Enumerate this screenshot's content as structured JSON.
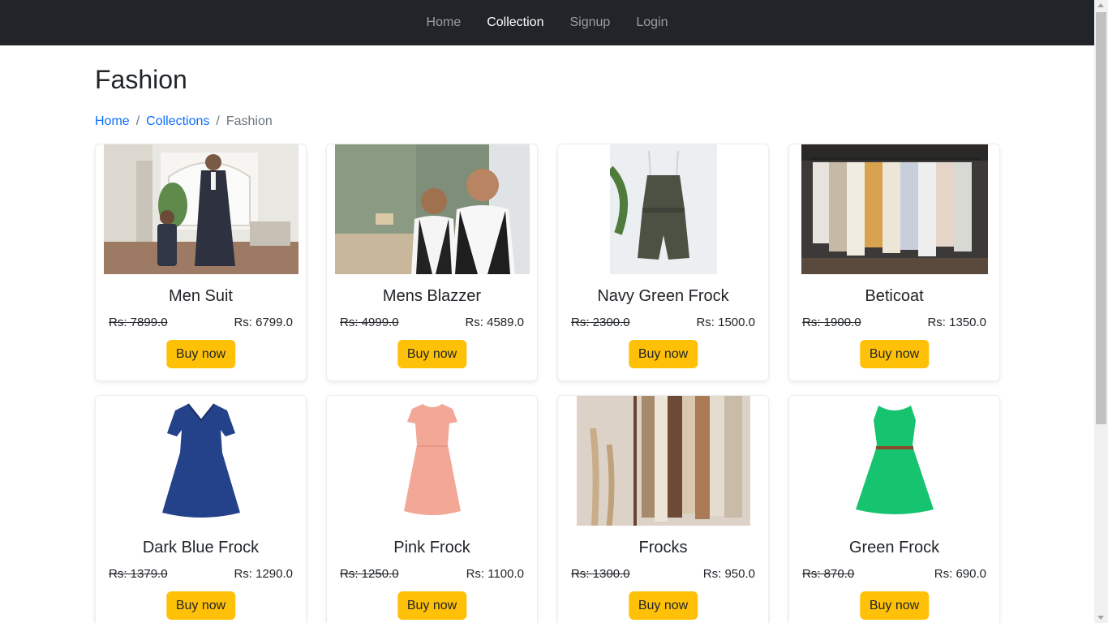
{
  "nav": {
    "items": [
      {
        "label": "Home",
        "active": false
      },
      {
        "label": "Collection",
        "active": true
      },
      {
        "label": "Signup",
        "active": false
      },
      {
        "label": "Login",
        "active": false
      }
    ]
  },
  "page": {
    "title": "Fashion",
    "breadcrumb": [
      "Home",
      "Collections",
      "Fashion"
    ]
  },
  "products": [
    {
      "name": "Men Suit",
      "old_price": "Rs: 7899.0",
      "new_price": "Rs: 6799.0",
      "button": "Buy now",
      "image": "men-suit-photo"
    },
    {
      "name": "Mens Blazzer",
      "old_price": "Rs: 4999.0",
      "new_price": "Rs: 4589.0",
      "button": "Buy now",
      "image": "mens-blazer-photo"
    },
    {
      "name": "Navy Green Frock",
      "old_price": "Rs: 2300.0",
      "new_price": "Rs: 1500.0",
      "button": "Buy now",
      "image": "green-romper-photo"
    },
    {
      "name": "Beticoat",
      "old_price": "Rs: 1900.0",
      "new_price": "Rs: 1350.0",
      "button": "Buy now",
      "image": "clothing-rack-photo"
    },
    {
      "name": "Dark Blue Frock",
      "old_price": "Rs: 1379.0",
      "new_price": "Rs: 1290.0",
      "button": "Buy now",
      "image": "dark-blue-dress-photo"
    },
    {
      "name": "Pink Frock",
      "old_price": "Rs: 1250.0",
      "new_price": "Rs: 1100.0",
      "button": "Buy now",
      "image": "pink-dress-photo"
    },
    {
      "name": "Frocks",
      "old_price": "Rs: 1300.0",
      "new_price": "Rs: 950.0",
      "button": "Buy now",
      "image": "neutral-clothes-photo"
    },
    {
      "name": "Green Frock",
      "old_price": "Rs: 870.0",
      "new_price": "Rs: 690.0",
      "button": "Buy now",
      "image": "green-dress-photo"
    }
  ],
  "colors": {
    "navbar": "#212529",
    "link": "#0d6efd",
    "button": "#ffc107"
  }
}
